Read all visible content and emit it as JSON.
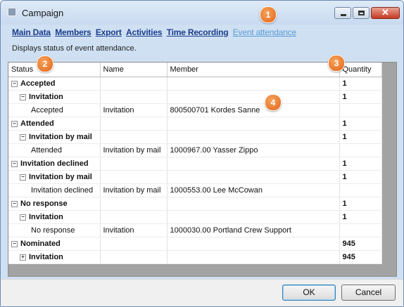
{
  "window": {
    "title": "Campaign"
  },
  "menu": {
    "main_data": "Main Data",
    "members": "Members",
    "export": "Export",
    "activities": "Activities",
    "time_recording": "Time Recording",
    "event_attendance": "Event attendance"
  },
  "description": "Displays status of event attendance.",
  "table": {
    "headers": [
      "Status",
      "Name",
      "Member",
      "Quantity"
    ],
    "rows": [
      {
        "status": "Accepted",
        "name": "",
        "member": "",
        "quantity": "1"
      },
      {
        "status": "Invitation",
        "name": "",
        "member": "",
        "quantity": "1"
      },
      {
        "status": "Accepted",
        "name": "Invitation",
        "member": "800500701 Kordes Sanne",
        "quantity": ""
      },
      {
        "status": "Attended",
        "name": "",
        "member": "",
        "quantity": "1"
      },
      {
        "status": "Invitation by mail",
        "name": "",
        "member": "",
        "quantity": "1"
      },
      {
        "status": "Attended",
        "name": "Invitation by mail",
        "member": "1000967.00 Yasser Zippo",
        "quantity": ""
      },
      {
        "status": "Invitation declined",
        "name": "",
        "member": "",
        "quantity": "1"
      },
      {
        "status": "Invitation by mail",
        "name": "",
        "member": "",
        "quantity": "1"
      },
      {
        "status": "Invitation declined",
        "name": "Invitation by mail",
        "member": "1000553.00 Lee McCowan",
        "quantity": ""
      },
      {
        "status": "No response",
        "name": "",
        "member": "",
        "quantity": "1"
      },
      {
        "status": "Invitation",
        "name": "",
        "member": "",
        "quantity": "1"
      },
      {
        "status": "No response",
        "name": "Invitation",
        "member": "1000030.00 Portland Crew Support",
        "quantity": ""
      },
      {
        "status": "Nominated",
        "name": "",
        "member": "",
        "quantity": "945"
      },
      {
        "status": "Invitation",
        "name": "",
        "member": "",
        "quantity": "945"
      }
    ]
  },
  "callouts": [
    "1",
    "2",
    "3",
    "4"
  ],
  "buttons": {
    "ok": "OK",
    "cancel": "Cancel"
  },
  "toggles": {
    "expanded": "−",
    "collapsed": "+"
  },
  "icons": {
    "app": "campaign-app-icon",
    "minimize": "minimize-icon",
    "maximize": "maximize-icon",
    "close": "close-icon"
  },
  "colors": {
    "link": "#1b3d8c",
    "active_link": "#5b9bd5",
    "callout": "#e8782a",
    "close": "#c43b24"
  }
}
